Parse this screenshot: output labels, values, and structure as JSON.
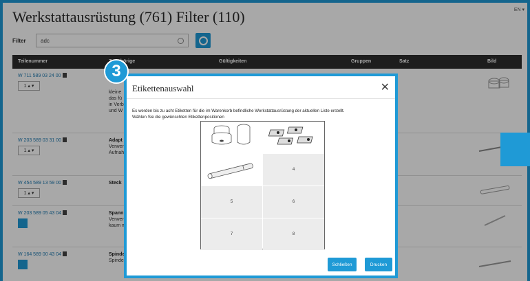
{
  "page": {
    "title": "Werkstattausrüstung (761) Filter (110)",
    "language": "EN ▾",
    "filter_label": "Filter",
    "filter_value": "adc"
  },
  "table": {
    "headers": [
      "Teilenummer",
      "Zugehörige",
      "Gültigkeiten",
      "Gruppen",
      "Satz",
      "Bild"
    ],
    "rows": [
      {
        "part_number": "W 711 589 03 24 00",
        "qty": "1 ▴ ▾",
        "title": "",
        "lines": [
          "kleine",
          "das fü",
          "in Verb",
          "und W"
        ]
      },
      {
        "part_number": "W 203 589 03 31 00",
        "qty": "1 ▴ ▾",
        "title": "Adapt",
        "lines": [
          "Verwen",
          "Aufnah"
        ]
      },
      {
        "part_number": "W 454 589 13 59 00",
        "qty": "1 ▴ ▾",
        "title": "Steck",
        "lines": []
      },
      {
        "part_number": "W 203 589 05 43 04",
        "qty": "",
        "title": "Spann",
        "lines": [
          "Verwen",
          "kaum m"
        ]
      },
      {
        "part_number": "W 164 589 00 43 04",
        "qty": "",
        "title": "Spinde",
        "lines": [
          "Spinde"
        ]
      }
    ]
  },
  "modal": {
    "title": "Etikettenauswahl",
    "close_glyph": "✕",
    "text_line1": "Es werden bis zu acht Etiketten für die im Warenkorb befindliche Werkstattausrüstung der aktuellen Liste erstellt.",
    "text_line2": "Wählen Sie die gewünschten Etikettenpositionen",
    "positions": [
      "4",
      "5",
      "6",
      "7",
      "8"
    ],
    "close_button": "Schließen",
    "print_button": "Drucken"
  },
  "callout": {
    "number": "3"
  },
  "colors": {
    "accent": "#1f9ad6",
    "header_bg": "#2d2d2d",
    "cell_grey": "#ececec"
  }
}
